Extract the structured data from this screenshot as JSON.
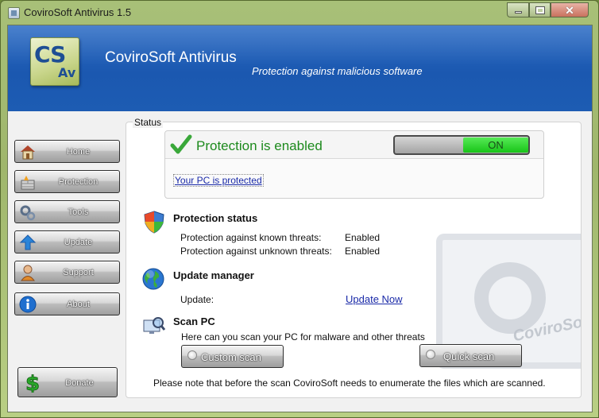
{
  "window": {
    "title": "CoviroSoft Antivirus 1.5",
    "controls": {
      "minimize": "minimize-icon",
      "maximize": "maximize-icon",
      "close": "close-icon"
    }
  },
  "banner": {
    "logo_top": "CS",
    "logo_bottom": "Av",
    "title": "CoviroSoft Antivirus",
    "subtitle": "Protection against malicious software"
  },
  "sidebar": {
    "items": [
      {
        "label": "Home",
        "icon": "house-icon"
      },
      {
        "label": "Protection",
        "icon": "firewall-icon"
      },
      {
        "label": "Tools",
        "icon": "gears-icon"
      },
      {
        "label": "Update",
        "icon": "up-arrow-icon"
      },
      {
        "label": "Support",
        "icon": "support-person-icon"
      },
      {
        "label": "About",
        "icon": "info-icon"
      }
    ],
    "donate": {
      "label": "Donate",
      "icon": "dollar-icon"
    }
  },
  "status": {
    "legend": "Status",
    "protection_title": "Protection is enabled",
    "toggle_label": "ON",
    "pc_link": "Your PC is protected",
    "watermark_text": "CoviroSoft"
  },
  "protection_status": {
    "title": "Protection status",
    "rows": [
      {
        "label": "Protection against known threats:",
        "value": "Enabled"
      },
      {
        "label": "Protection against unknown threats:",
        "value": "Enabled"
      }
    ]
  },
  "update_manager": {
    "title": "Update manager",
    "label": "Update:",
    "link": "Update Now"
  },
  "scan": {
    "title": "Scan PC",
    "description": "Here can you scan your PC for malware and other threats",
    "custom_label": "Custom scan",
    "quick_label": "Quick scan",
    "note": "Please note that before the scan CoviroSoft needs to enumerate the files which are scanned."
  },
  "colors": {
    "banner_blue": "#1d5cb3",
    "protection_green": "#1d8a1d",
    "toggle_on": "#18c418",
    "link_blue": "#1a2aa8"
  }
}
